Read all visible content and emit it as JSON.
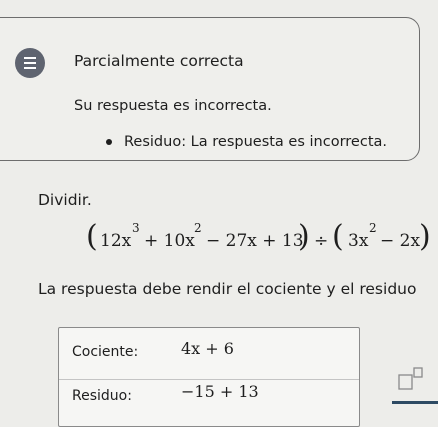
{
  "feedback": {
    "title": "Parcialmente correcta",
    "message": "Su respuesta es incorrecta.",
    "bullet": "Residuo: La respuesta es incorrecta."
  },
  "problem": {
    "instruction": "Dividir.",
    "equation": {
      "open1": "(",
      "t1": "12x",
      "e1": "3",
      "t2": "+ 10x",
      "e2": "2",
      "t3": "− 27x + 13",
      "close1": ")",
      "div": "÷",
      "open2": "(",
      "t4": "3x",
      "e4": "2",
      "t5": "− 2x",
      "close2": ")"
    },
    "note": "La respuesta debe rendir el cociente y el residuo"
  },
  "answer": {
    "cociente_label": "Cociente:",
    "cociente_value": "4x + 6",
    "residuo_label": "Residuo:",
    "residuo_value": "−15 + 13"
  },
  "tools": {
    "exponent_icon": "exponent-box-icon"
  },
  "colors": {
    "background": "#ededea",
    "icon_bg": "#5f6470",
    "accent_bar": "#2d4a63"
  }
}
